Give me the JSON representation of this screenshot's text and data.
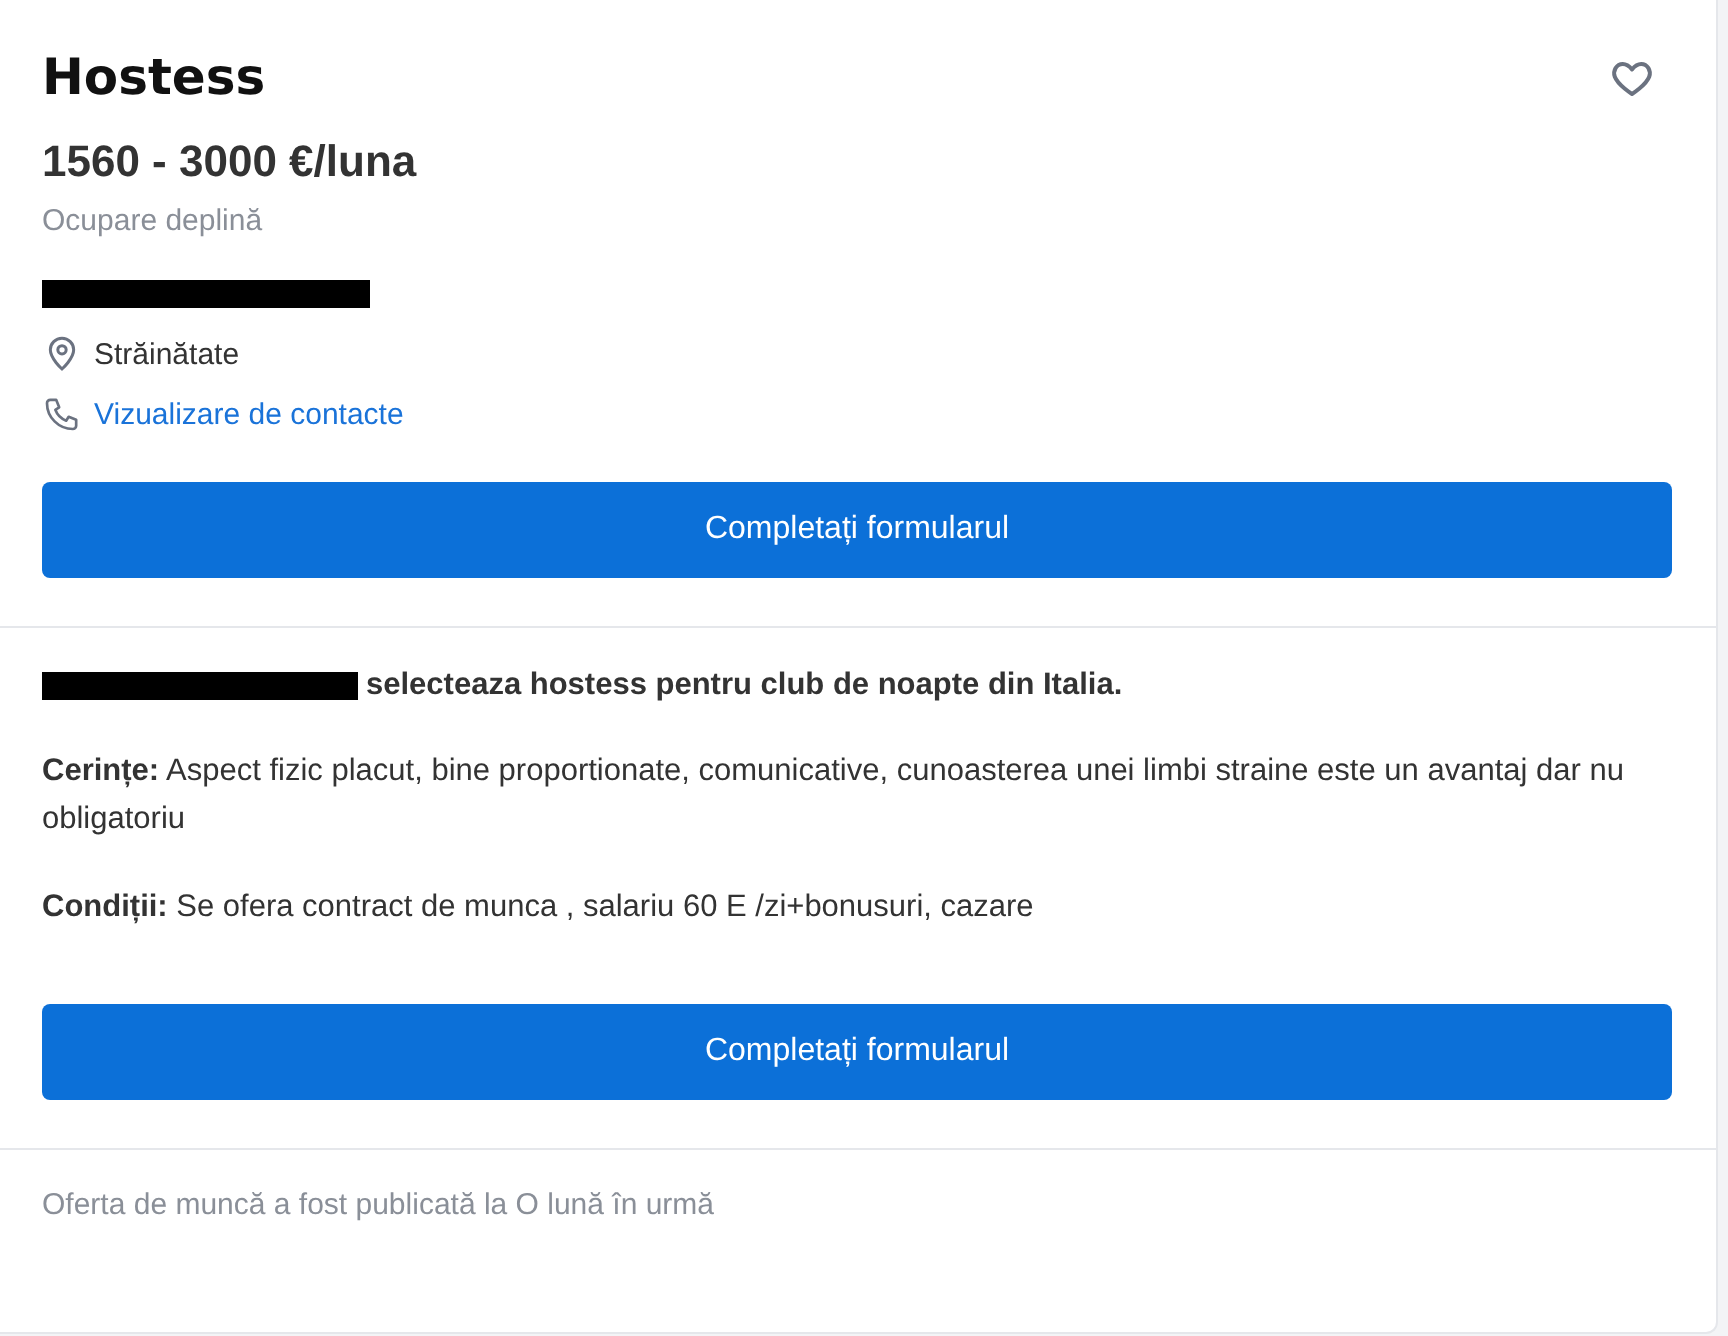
{
  "job": {
    "title": "Hostess",
    "favorite": false,
    "salary": "1560 - 3000 €/luna",
    "employment": "Ocupare deplină",
    "company": {
      "redacted": true
    },
    "location": "Străinătate",
    "contacts_link": "Vizualizare de contacte",
    "apply_button": "Completați formularul"
  },
  "description": {
    "intro": {
      "redacted": true,
      "text": "selecteaza hostess pentru club de noapte din Italia."
    },
    "sections": [
      {
        "label": "Cerințe:",
        "text": "Aspect fizic placut, bine proportionate, comunicative, cunoasterea unei limbi straine este un avantaj dar nu obligatoriu"
      },
      {
        "label": "Condiții:",
        "text": "Se ofera contract de munca , salariu 60 E /zi+bonusuri, cazare"
      }
    ],
    "apply_button": "Completați formularul"
  },
  "footer": {
    "published": "Oferta de muncă a fost publicată la O lună în urmă"
  }
}
